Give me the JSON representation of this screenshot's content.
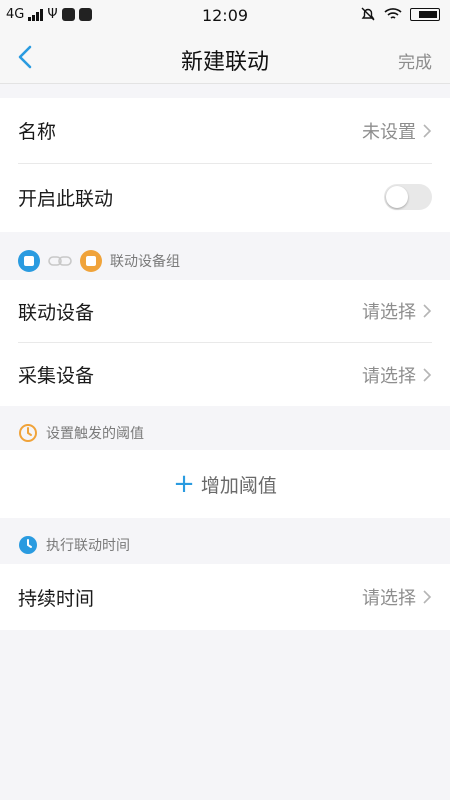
{
  "status_bar": {
    "network": "4G",
    "time": "12:09"
  },
  "nav": {
    "title": "新建联动",
    "done_label": "完成"
  },
  "basic": {
    "name_label": "名称",
    "name_value": "未设置",
    "enable_label": "开启此联动",
    "enabled": false
  },
  "device_group": {
    "header": "联动设备组",
    "linked_device_label": "联动设备",
    "linked_device_value": "请选择",
    "collect_device_label": "采集设备",
    "collect_device_value": "请选择"
  },
  "threshold": {
    "header": "设置触发的阈值",
    "add_label": "增加阈值"
  },
  "execution": {
    "header": "执行联动时间",
    "duration_label": "持续时间",
    "duration_value": "请选择"
  },
  "colors": {
    "accent_blue": "#2a9be0",
    "accent_orange": "#f0a33a"
  }
}
